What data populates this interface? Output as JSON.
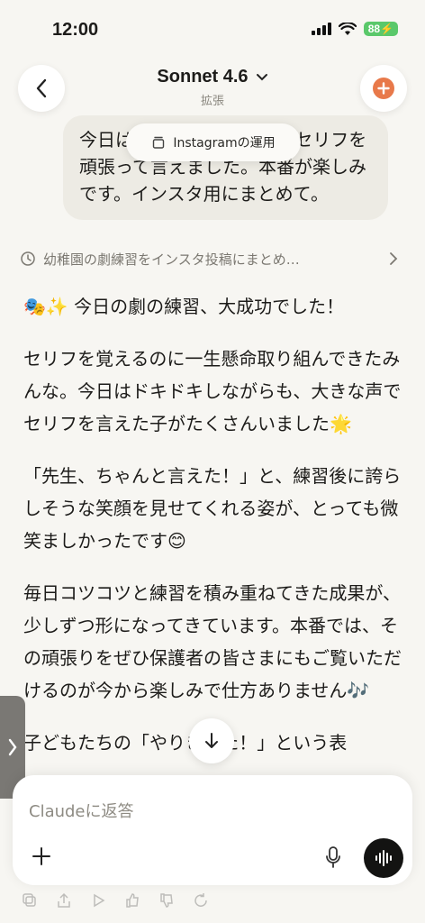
{
  "status_bar": {
    "time": "12:00",
    "battery": "88"
  },
  "header": {
    "model_name": "Sonnet 4.6",
    "mode": "拡張"
  },
  "user_message": "今日は劇の練習で、みんなセリフを頑張って言えました。本番が楽しみです。インスタ用にまとめて。",
  "tooltip": {
    "label": "Instagramの運用"
  },
  "thinking": {
    "summary": "幼稚園の劇練習をインスタ投稿にまとめ…"
  },
  "response": {
    "paragraphs": [
      "🎭✨ 今日の劇の練習、大成功でした！",
      "セリフを覚えるのに一生懸命取り組んできたみんな。今日はドキドキしながらも、大きな声でセリフを言えた子がたくさんいました🌟",
      "「先生、ちゃんと言えた！」と、練習後に誇らしそうな笑顔を見せてくれる姿が、とっても微笑ましかったです😊",
      "毎日コツコツと練習を積み重ねてきた成果が、少しずつ形になってきています。本番では、その頑張りをぜひ保護者の皆さまにもご覧いただけるのが今から楽しみで仕方ありません🎶",
      "子どもたちの「やりきった！」という表"
    ]
  },
  "composer": {
    "placeholder": "Claudeに返答"
  },
  "colors": {
    "accent": "#e8794a",
    "voice_button": "#131312",
    "battery": "#5ac86a"
  }
}
